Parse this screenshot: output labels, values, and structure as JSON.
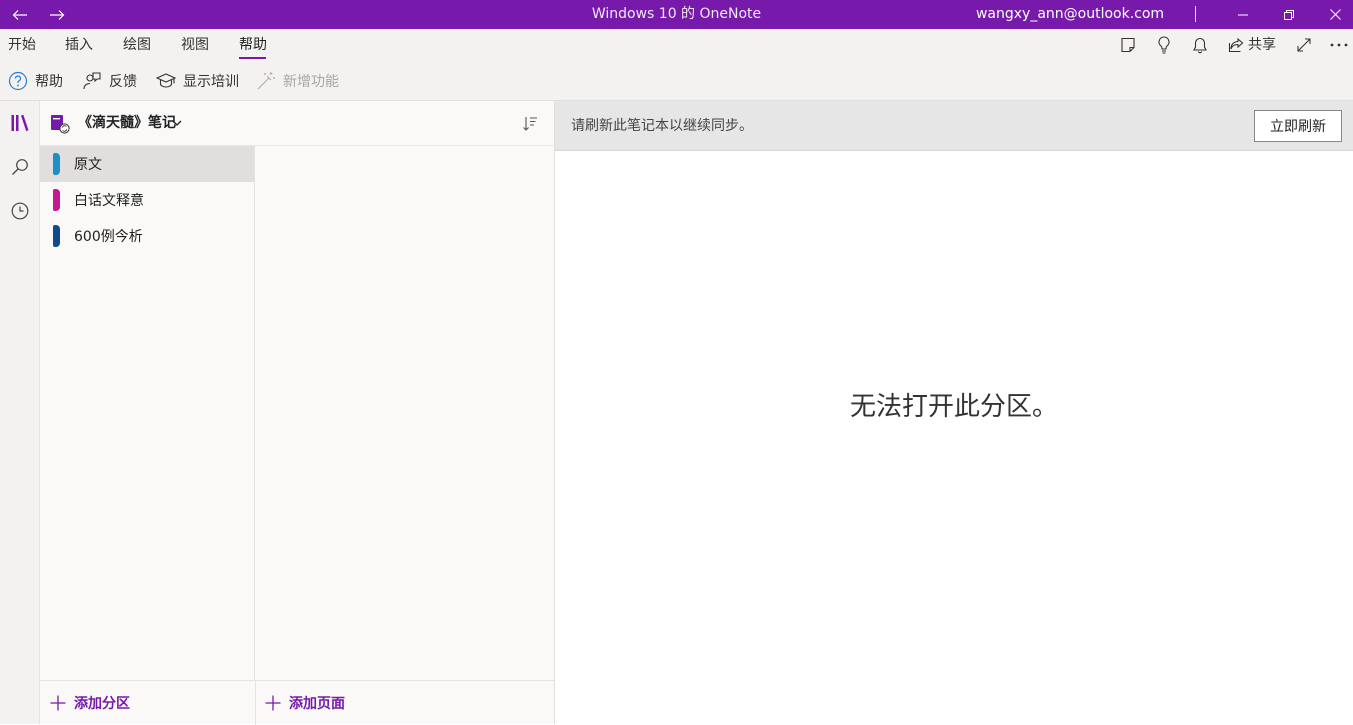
{
  "app": {
    "title": "Windows 10 的 OneNote",
    "account": "wangxy_ann@outlook.com"
  },
  "window_controls": {
    "back_icon": "arrow-left-icon",
    "forward_icon": "arrow-right-icon",
    "minimize_icon": "minimize-icon",
    "restore_icon": "restore-icon",
    "close_icon": "close-icon"
  },
  "menu_tabs": [
    {
      "label": "开始"
    },
    {
      "label": "插入"
    },
    {
      "label": "绘图"
    },
    {
      "label": "视图"
    },
    {
      "label": "帮助",
      "active": true
    }
  ],
  "top_right": {
    "share_label": "共享",
    "icons": [
      "sticky-note-icon",
      "lightbulb-icon",
      "bell-icon",
      "share-icon",
      "expand-icon",
      "more-icon"
    ]
  },
  "ribbon": {
    "help_label": "帮助",
    "feedback_label": "反馈",
    "training_label": "显示培训",
    "whatsnew_label": "新增功能"
  },
  "notebook": {
    "name": "《滴天髓》笔记"
  },
  "sections": [
    {
      "label": "原文",
      "color": "#1e90c8",
      "selected": true
    },
    {
      "label": "白话文释意",
      "color": "#c6168d",
      "selected": false
    },
    {
      "label": "600例今析",
      "color": "#0f4b8c",
      "selected": false
    }
  ],
  "footer": {
    "add_section_label": "添加分区",
    "add_page_label": "添加页面"
  },
  "sync": {
    "message": "请刷新此笔记本以继续同步。",
    "button_label": "立即刷新"
  },
  "content": {
    "message": "无法打开此分区。"
  },
  "colors": {
    "accent": "#7719aa",
    "chrome": "#f3f2f1"
  }
}
